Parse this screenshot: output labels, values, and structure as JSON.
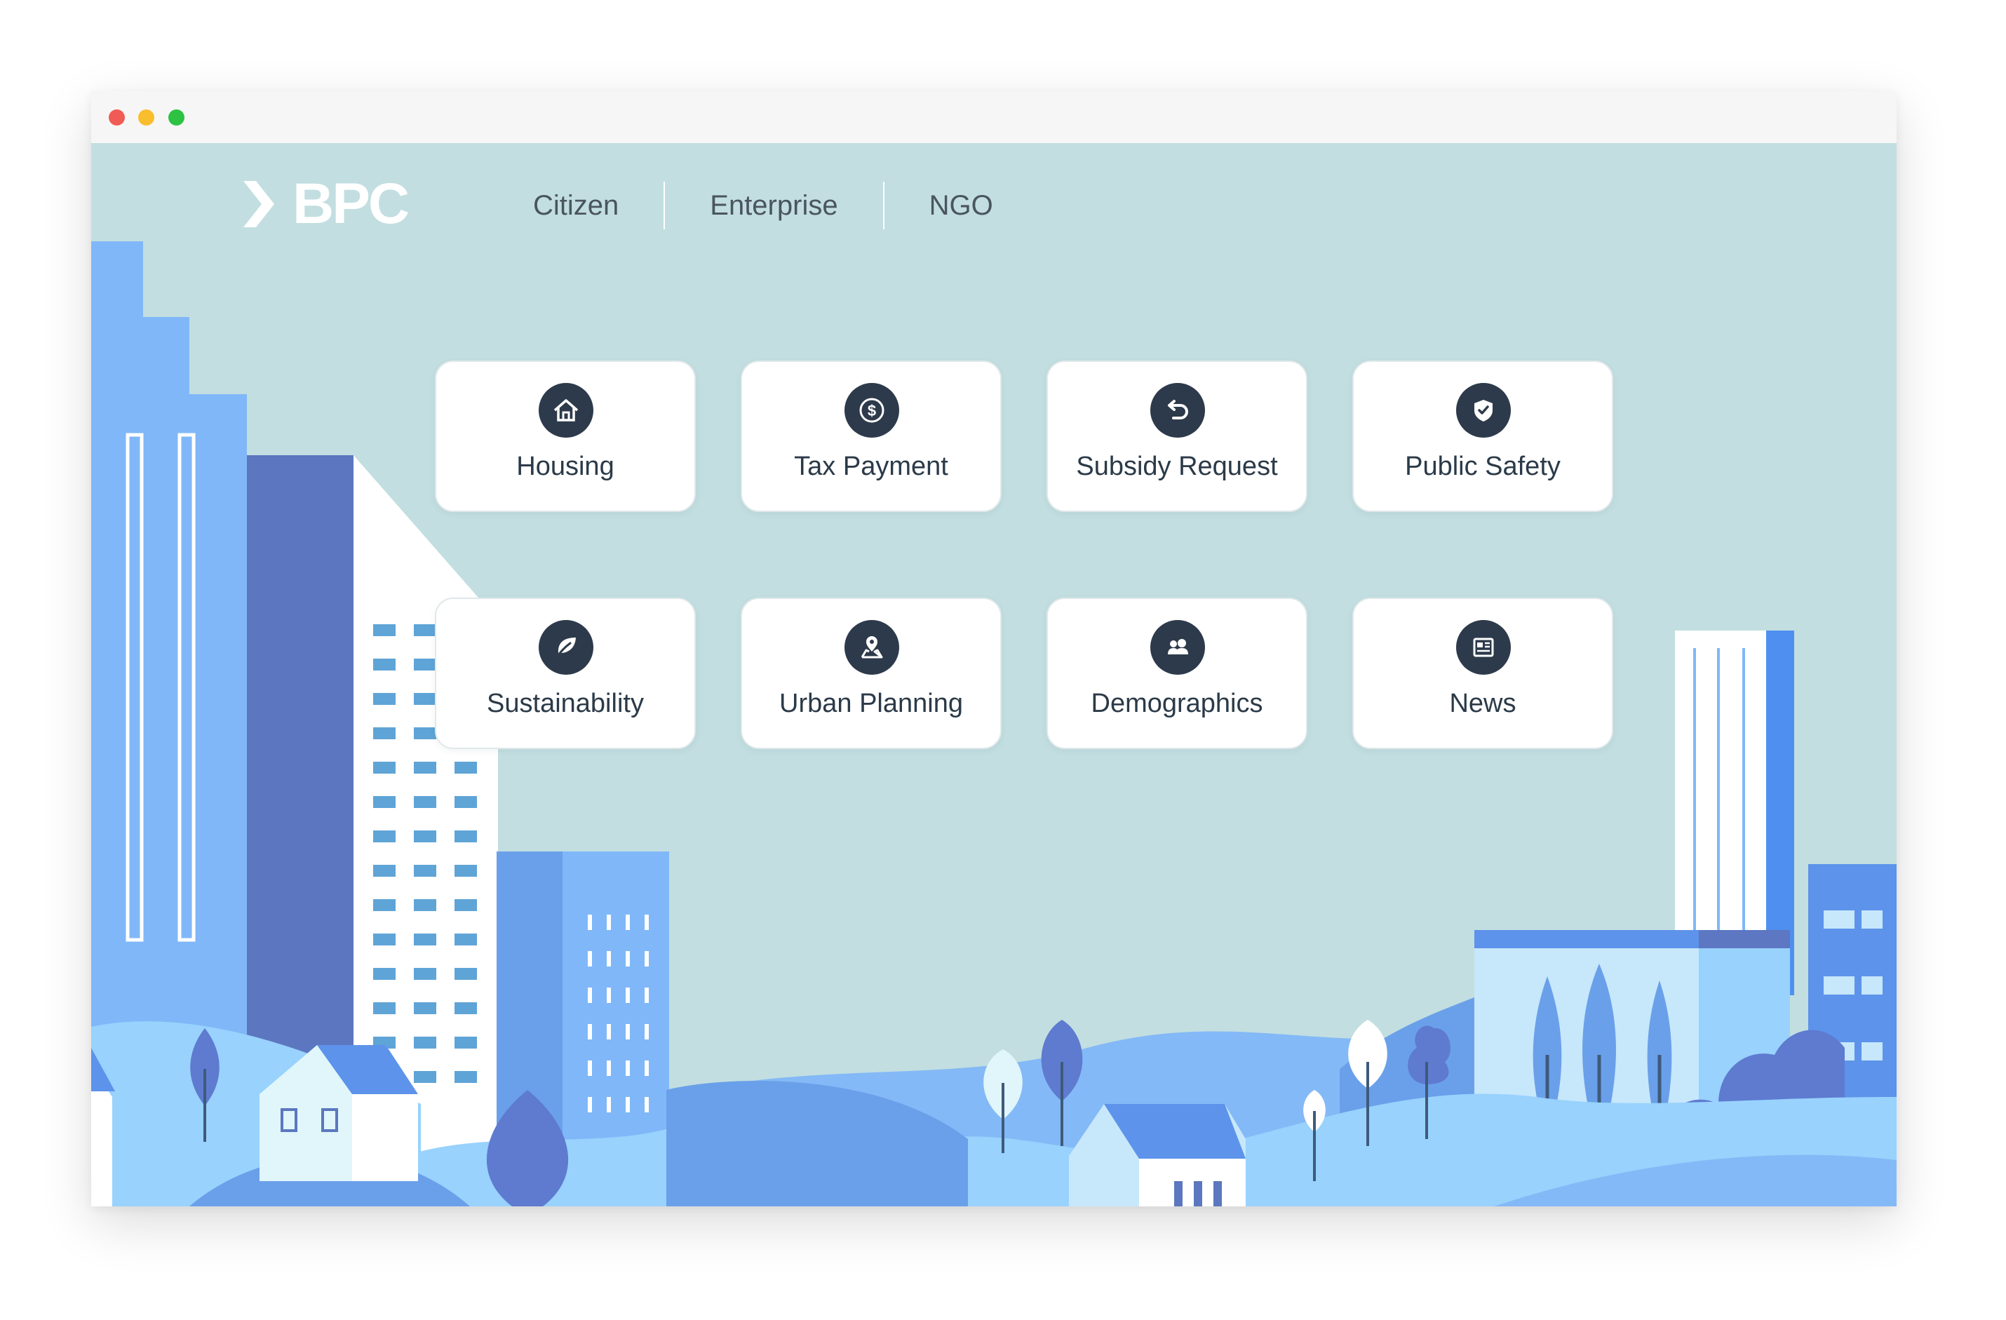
{
  "brand": {
    "name": "BPC"
  },
  "nav": {
    "items": [
      "Citizen",
      "Enterprise",
      "NGO"
    ]
  },
  "services": [
    {
      "label": "Housing",
      "icon": "house-icon"
    },
    {
      "label": "Tax Payment",
      "icon": "dollar-icon"
    },
    {
      "label": "Subsidy Request",
      "icon": "return-arrow-icon"
    },
    {
      "label": "Public Safety",
      "icon": "shield-check-icon"
    },
    {
      "label": "Sustainability",
      "icon": "leaf-icon"
    },
    {
      "label": "Urban Planning",
      "icon": "map-pin-icon"
    },
    {
      "label": "Demographics",
      "icon": "people-icon"
    },
    {
      "label": "News",
      "icon": "newspaper-icon"
    }
  ],
  "colors": {
    "sky": "#c2dee0",
    "icon_bg": "#2d3a4b",
    "tile_text": "#2b3a48",
    "nav_text": "#4a5560",
    "building_light": "#80b7f8",
    "building_dark": "#5c77bf",
    "hill_blue": "#6aa0ea",
    "hill_light": "#98d2fd"
  }
}
